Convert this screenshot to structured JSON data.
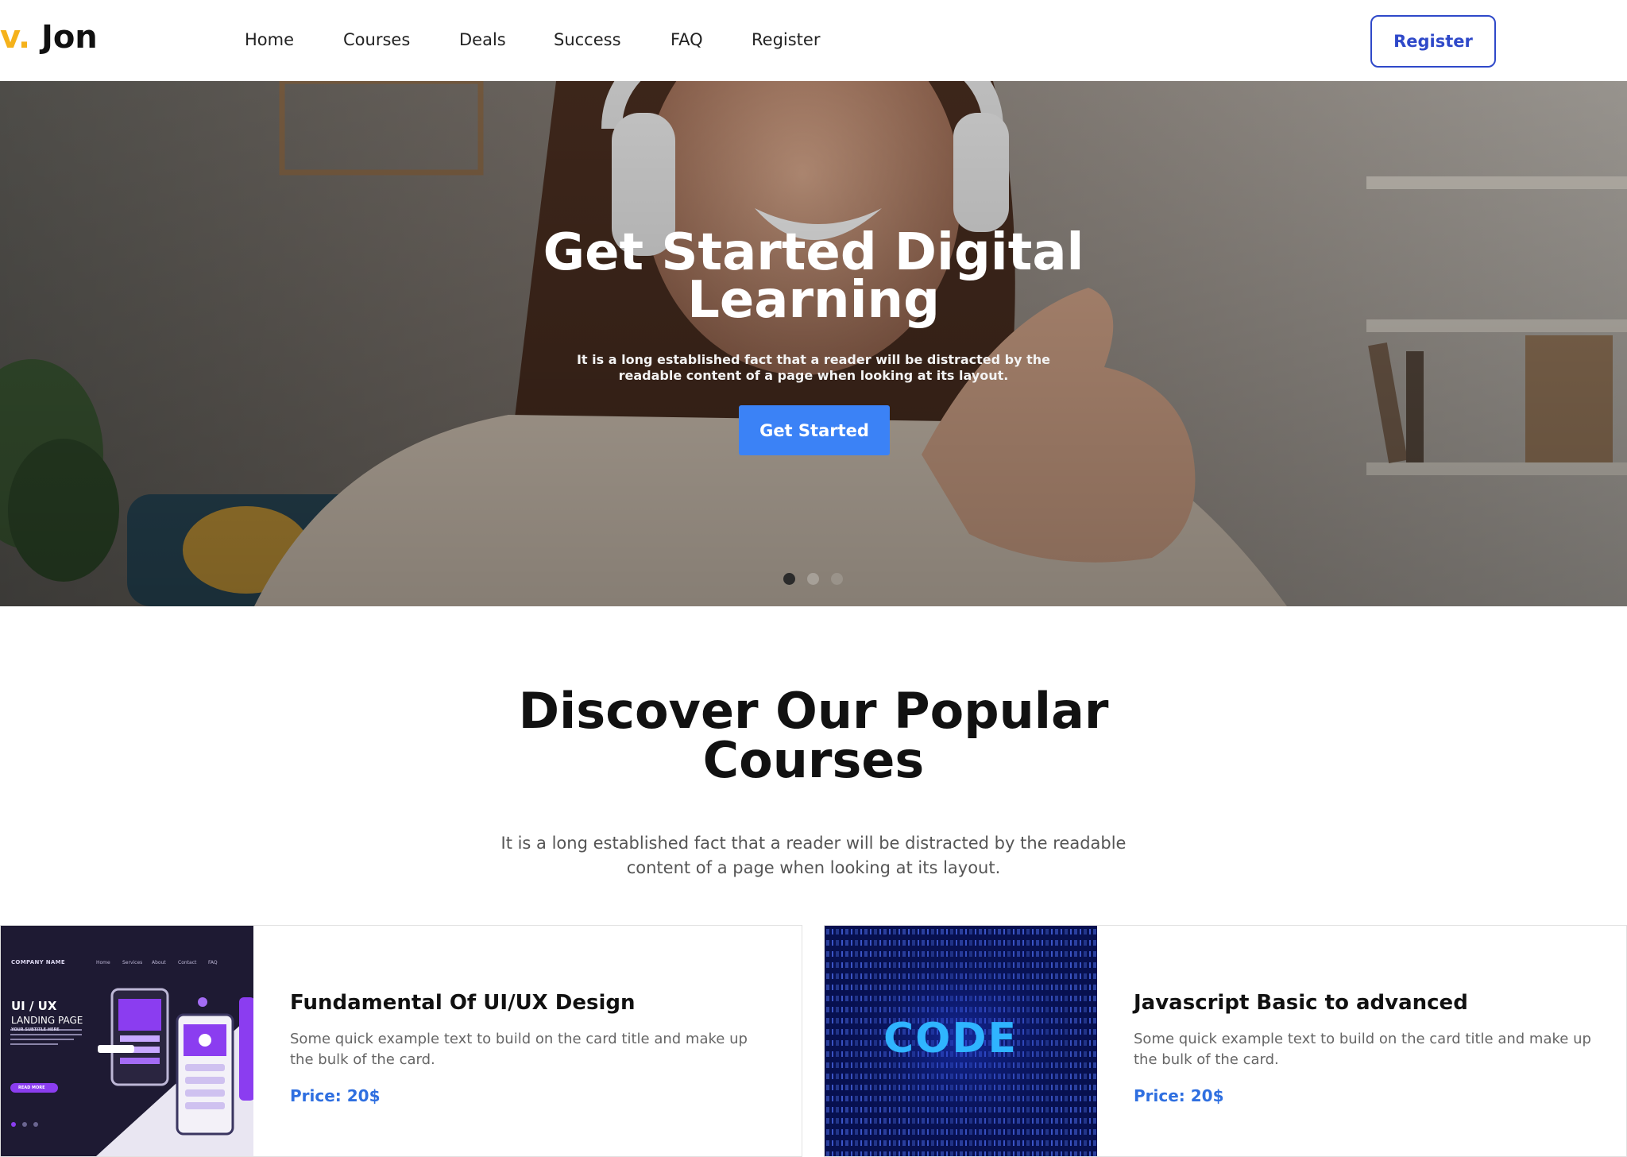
{
  "brand": {
    "prefix": "v.",
    "name": " Jon"
  },
  "nav": {
    "links": [
      "Home",
      "Courses",
      "Deals",
      "Success",
      "FAQ",
      "Register"
    ],
    "cta": "Register"
  },
  "hero": {
    "title": "Get Started Digital Learning",
    "subtitle": "It is a long established fact that a reader will be distracted by the readable content of a page when looking at its layout.",
    "button": "Get Started",
    "slides": 3,
    "active_slide": 1
  },
  "courses": {
    "title": "Discover Our Popular Courses",
    "subtitle": "It is a long established fact that a reader will be distracted by the readable content of a page when looking at its layout.",
    "items": [
      {
        "title": "Fundamental Of UI/UX Design",
        "text": "Some quick example text to build on the card title and make up the bulk of the card.",
        "price": "Price: 20$",
        "thumb": {
          "company": "COMPANY NAME",
          "menu": [
            "Home",
            "Services",
            "About",
            "Contact",
            "FAQ"
          ],
          "heading": "UI / UX",
          "subheading": "LANDING PAGE",
          "tagline": "YOUR SUBTITLE HERE",
          "button": "READ MORE"
        }
      },
      {
        "title": "Javascript Basic to advanced",
        "text": "Some quick example text to build on the card title and make up the bulk of the card.",
        "price": "Price: 20$",
        "thumb": {
          "word": "CODE"
        }
      }
    ]
  },
  "colors": {
    "accent": "#f5b21b",
    "primary": "#2f49c9",
    "button": "#3b82f6",
    "price": "#2f6fe0"
  }
}
